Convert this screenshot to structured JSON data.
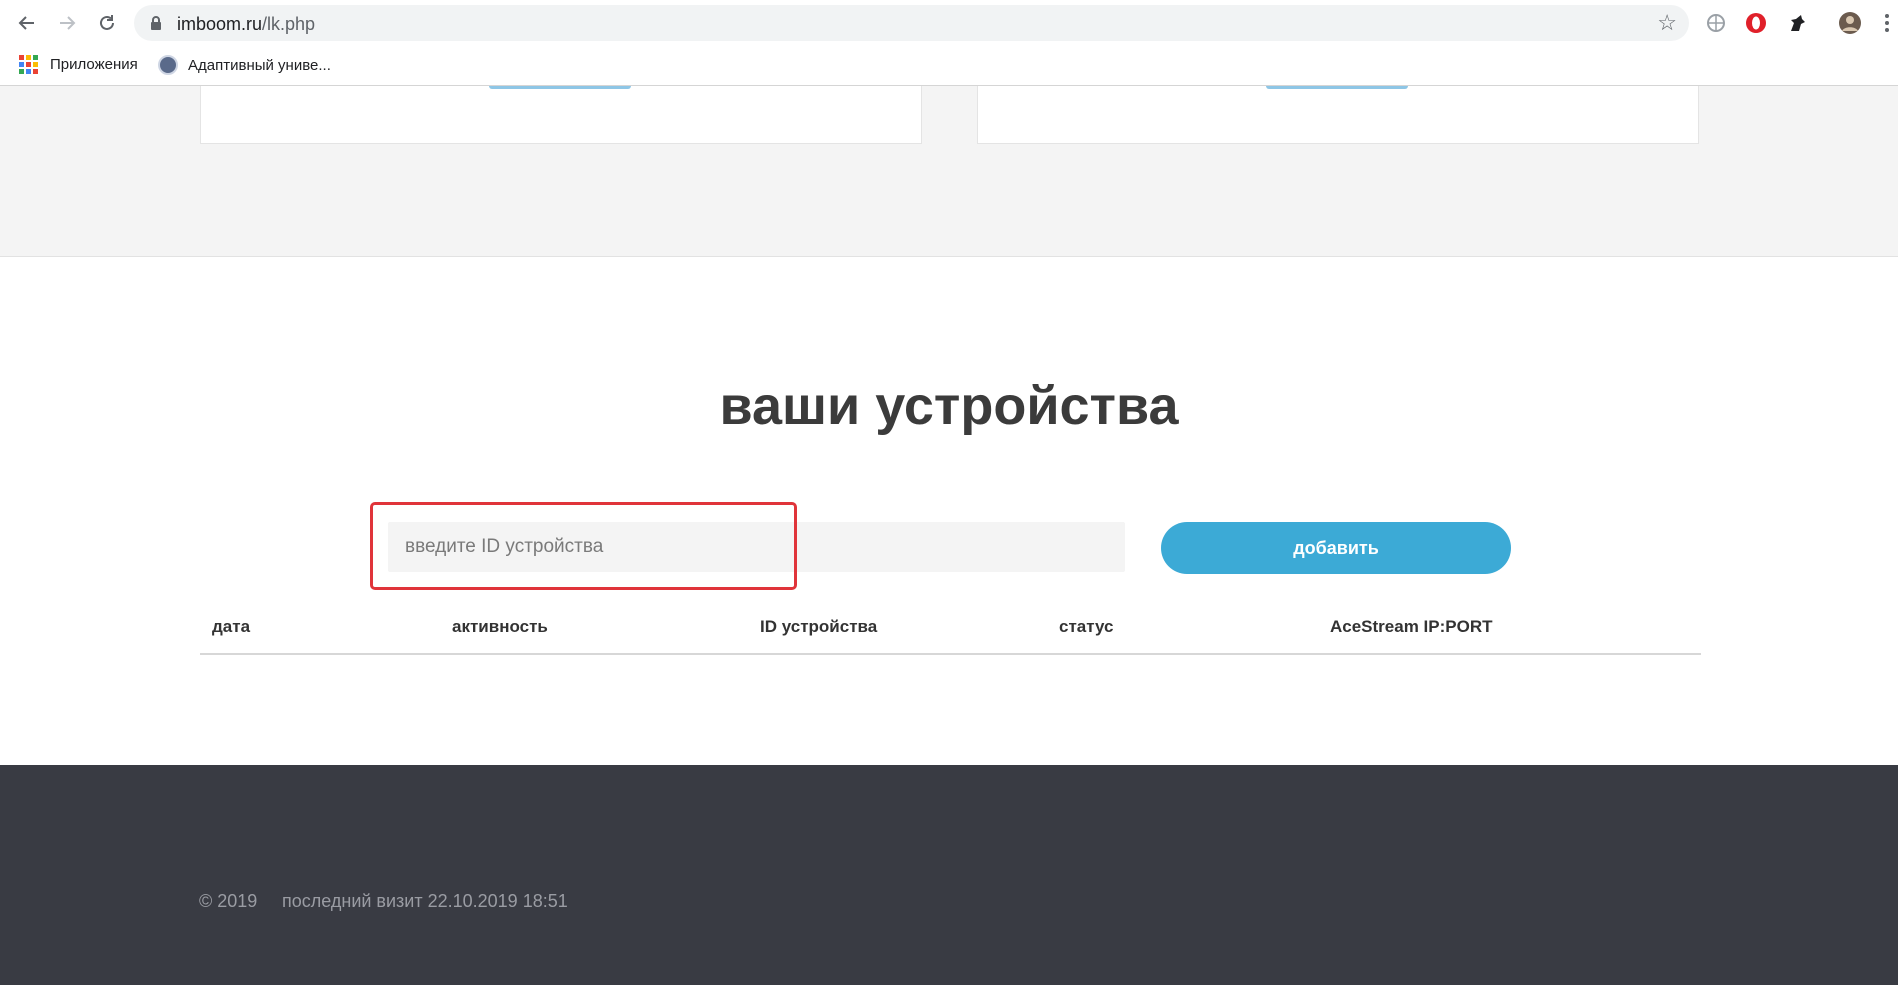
{
  "browser": {
    "url_host": "imboom.ru",
    "url_path": "/lk.php",
    "bookmarks": [
      {
        "label": "Приложения",
        "icon": "apps-grid-icon"
      },
      {
        "label": "Адаптивный униве...",
        "icon": "globe-icon"
      }
    ]
  },
  "devices": {
    "title": "ваши устройства",
    "input_placeholder": "введите ID устройства",
    "input_value": "",
    "add_label": "добавить",
    "columns": [
      "дата",
      "активность",
      "ID устройства",
      "статус",
      "AceStream IP:PORT"
    ],
    "rows": []
  },
  "footer": {
    "copyright": "© 2019",
    "last_visit": "последний визит 22.10.2019 18:51"
  },
  "colors": {
    "accent": "#3caad6",
    "highlight": "#e0343a",
    "footer_bg": "#393b43"
  }
}
